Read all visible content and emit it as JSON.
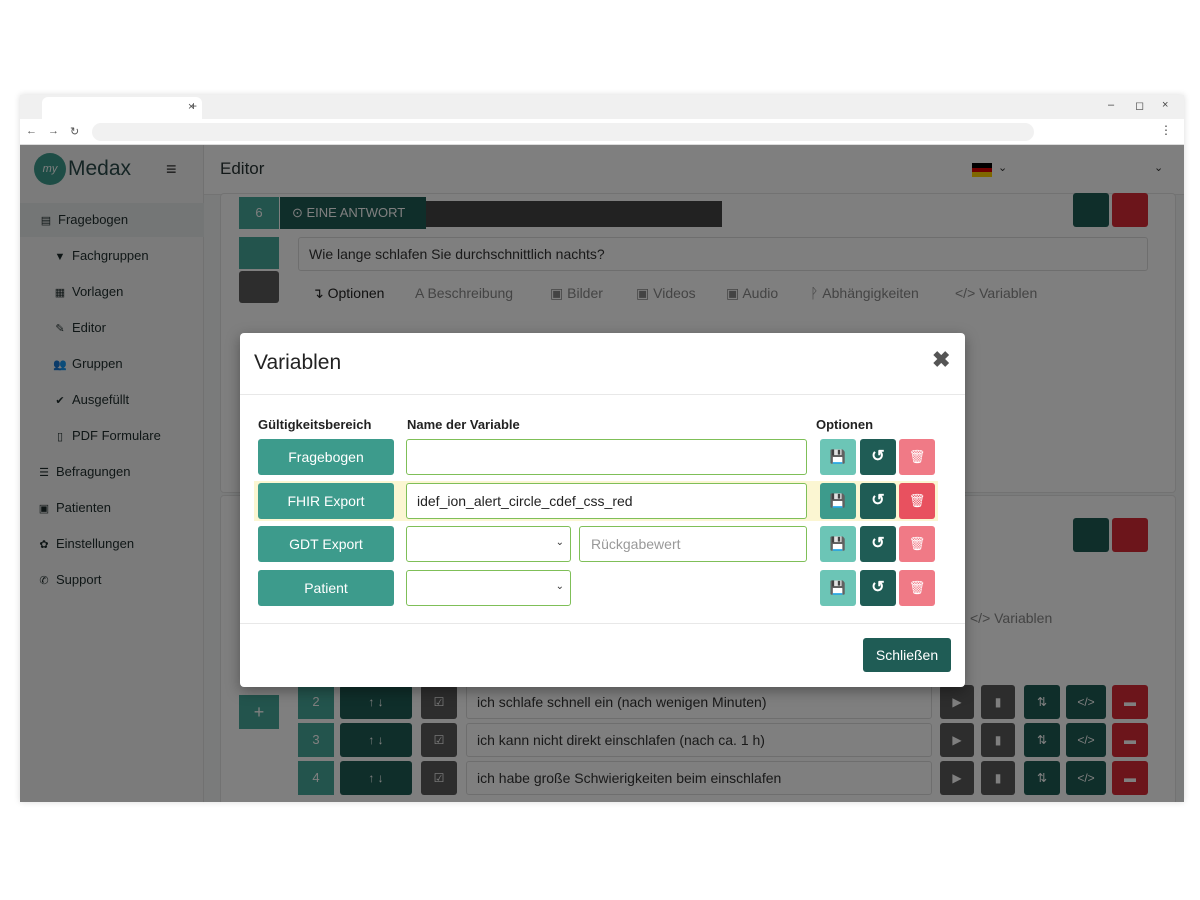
{
  "browser": {
    "tab_close": "×",
    "new_tab": "+",
    "back": "←",
    "forward": "→",
    "reload": "↻",
    "menu": "⋮",
    "minimize": "–",
    "restore": "◻",
    "close": "×"
  },
  "sidebar": {
    "logo_badge": "my",
    "logo_text": "Medax",
    "menu_icon": "≡",
    "items": [
      {
        "label": "Fragebogen",
        "icon": "▤"
      },
      {
        "label": "Fachgruppen",
        "icon": "▼"
      },
      {
        "label": "Vorlagen",
        "icon": "▦"
      },
      {
        "label": "Editor",
        "icon": "✎"
      },
      {
        "label": "Gruppen",
        "icon": "👥"
      },
      {
        "label": "Ausgefüllt",
        "icon": "✔"
      },
      {
        "label": "PDF Formulare",
        "icon": "▯"
      },
      {
        "label": "Befragungen",
        "icon": "☰"
      },
      {
        "label": "Patienten",
        "icon": "▣"
      },
      {
        "label": "Einstellungen",
        "icon": "✿"
      },
      {
        "label": "Support",
        "icon": "✆"
      }
    ]
  },
  "topbar": {
    "title": "Editor",
    "chevron": "⌄"
  },
  "question": {
    "number": "6",
    "type": "⊙ EINE ANTWORT",
    "text": "Wie lange schlafen Sie durchschnittlich nachts?",
    "tabs": [
      "↴ Optionen",
      "A Beschreibung",
      "▣ Bilder",
      "▣ Videos",
      "▣ Audio",
      "ᚹ Abhängigkeiten",
      "</> Variablen"
    ],
    "side_num": "6",
    "partial_tab": "</> Variablen"
  },
  "answers": [
    {
      "num": "2",
      "text": "ich schlafe schnell ein (nach wenigen Minuten)"
    },
    {
      "num": "3",
      "text": "ich kann nicht direkt einschlafen (nach ca. 1 h)"
    },
    {
      "num": "4",
      "text": "ich habe große Schwierigkeiten beim einschlafen"
    }
  ],
  "modal": {
    "title": "Variablen",
    "close_icon": "✖",
    "col_scope": "Gültigkeitsbereich",
    "col_name": "Name der Variable",
    "col_options": "Optionen",
    "rows": [
      {
        "scope": "Fragebogen",
        "value": ""
      },
      {
        "scope": "FHIR Export",
        "value": "idef_ion_alert_circle_cdef_css_red"
      },
      {
        "scope": "GDT Export",
        "return_placeholder": "Rückgabewert"
      },
      {
        "scope": "Patient"
      }
    ],
    "save_icon": "💾",
    "reset_icon": "↺",
    "delete_icon": "🗑",
    "close_label": "Schließen"
  },
  "colors": {
    "teal": "#3d9b8c",
    "dark_teal": "#1f5c55",
    "red": "#d92b37",
    "highlight": "#fbf6d2",
    "input_border": "#7fbf58"
  }
}
